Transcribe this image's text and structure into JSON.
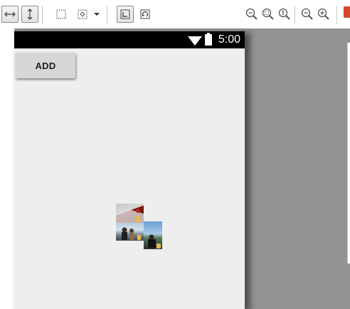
{
  "toolbar": {
    "buttons": [
      {
        "name": "fit-width-button",
        "icon": "horizontal-arrows-icon",
        "pressed": true
      },
      {
        "name": "fit-height-button",
        "icon": "vertical-arrows-icon",
        "pressed": true
      },
      {
        "name": "layout-bounds-button",
        "icon": "dotted-square-icon",
        "pressed": false
      },
      {
        "name": "resize-button",
        "icon": "expand-square-icon",
        "pressed": false
      },
      {
        "name": "dropdown-button",
        "icon": "caret-down-icon",
        "pressed": false
      },
      {
        "name": "show-constraints-button",
        "icon": "constraint-corner-icon",
        "pressed": true
      },
      {
        "name": "rotate-button",
        "icon": "rotate-square-icon",
        "pressed": false
      },
      {
        "name": "zoom-out-fit-button",
        "icon": "zoom-fit-out-icon",
        "pressed": false
      },
      {
        "name": "zoom-to-fit-button",
        "icon": "zoom-fit-icon",
        "pressed": false
      },
      {
        "name": "zoom-actual-button",
        "icon": "zoom-actual-size-icon",
        "pressed": false
      },
      {
        "name": "zoom-out-button",
        "icon": "zoom-out-icon",
        "pressed": false
      },
      {
        "name": "zoom-in-button",
        "icon": "zoom-in-icon",
        "pressed": false
      }
    ],
    "badge_color": "#d9452c"
  },
  "device": {
    "status_time": "5:00",
    "status_icons": [
      "wifi-icon",
      "battery-icon"
    ],
    "add_button_label": "ADD",
    "background": "#eeeeee"
  },
  "photos": [
    {
      "name": "photo-top",
      "colors": [
        "#7a1a12",
        "#c9c9c9"
      ]
    },
    {
      "name": "photo-middle",
      "colors": [
        "#6f8fb0",
        "#2b2b2b"
      ]
    },
    {
      "name": "photo-right",
      "colors": [
        "#4f86c5",
        "#1d1d1d"
      ]
    }
  ]
}
